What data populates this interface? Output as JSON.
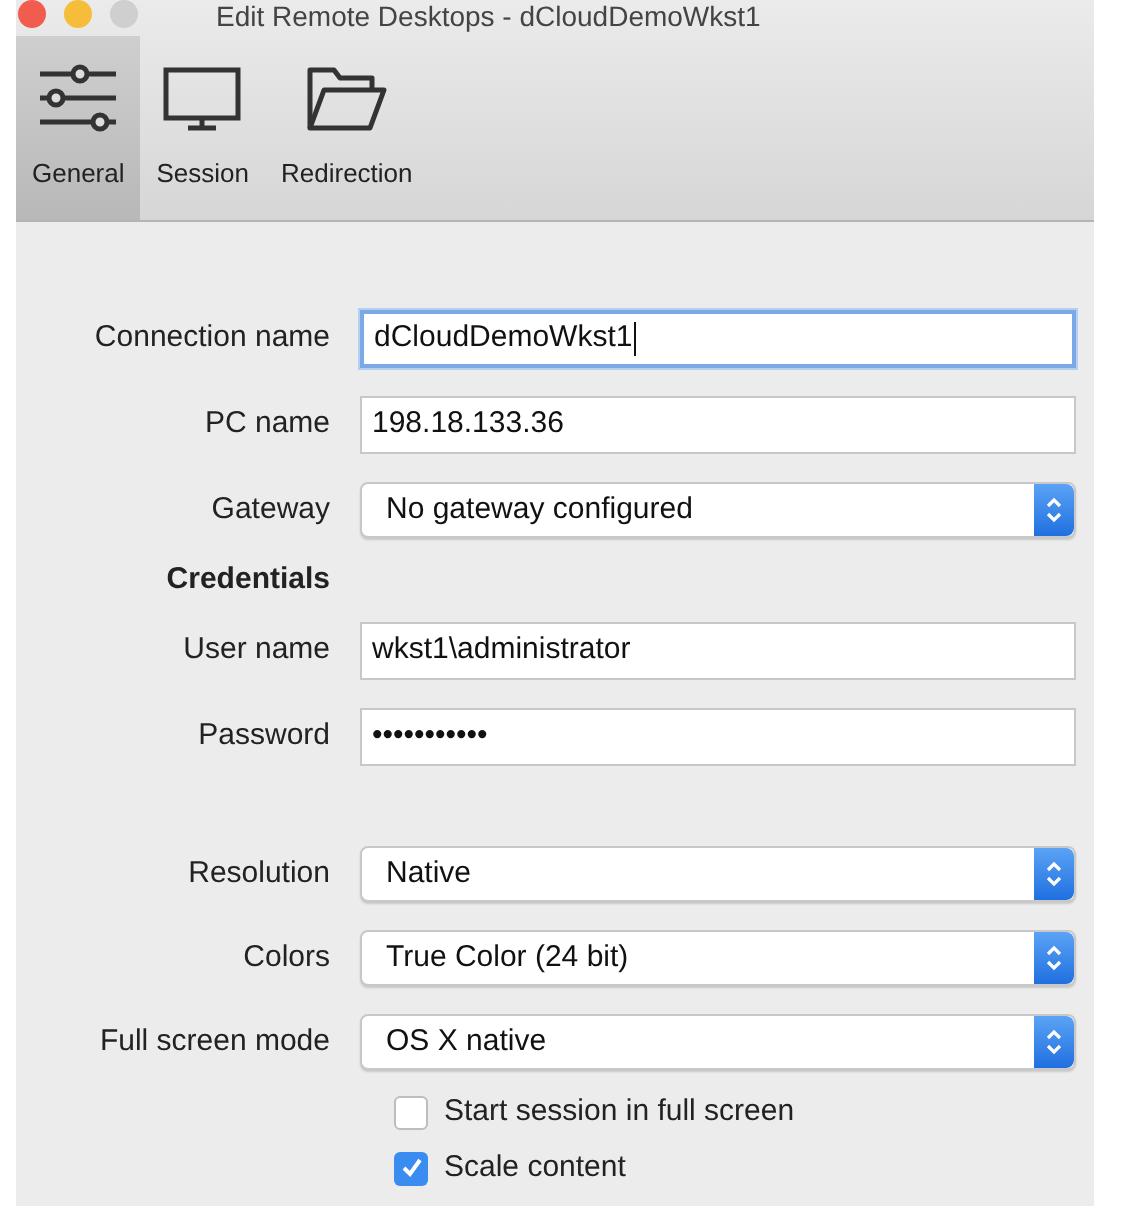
{
  "window": {
    "title": "Edit Remote Desktops - dCloudDemoWkst1"
  },
  "toolbar": [
    {
      "kind": "sliders",
      "label": "General",
      "selected": true
    },
    {
      "kind": "monitor",
      "label": "Session",
      "selected": false
    },
    {
      "kind": "folder",
      "label": "Redirection",
      "selected": false
    }
  ],
  "form_sections": [
    [
      {
        "kind": "text",
        "label": "Connection name",
        "value": "dCloudDemoWkst1",
        "focused": true
      },
      {
        "kind": "text",
        "label": "PC name",
        "value": "198.18.133.36",
        "focused": false
      },
      {
        "kind": "select",
        "label": "Gateway",
        "value": "No gateway configured"
      },
      {
        "kind": "heading",
        "label": "Credentials"
      },
      {
        "kind": "text",
        "label": "User name",
        "value": "wkst1\\administrator",
        "focused": false
      },
      {
        "kind": "text",
        "label": "Password",
        "value": "•••••••••••",
        "focused": false
      }
    ],
    [
      {
        "kind": "select",
        "label": "Resolution",
        "value": "Native"
      },
      {
        "kind": "select",
        "label": "Colors",
        "value": "True Color (24 bit)"
      },
      {
        "kind": "select",
        "label": "Full screen mode",
        "value": "OS X native"
      },
      {
        "kind": "checkbox",
        "label": "Start session in full screen",
        "checked": false
      },
      {
        "kind": "checkbox",
        "label": "Scale content",
        "checked": true
      }
    ]
  ]
}
